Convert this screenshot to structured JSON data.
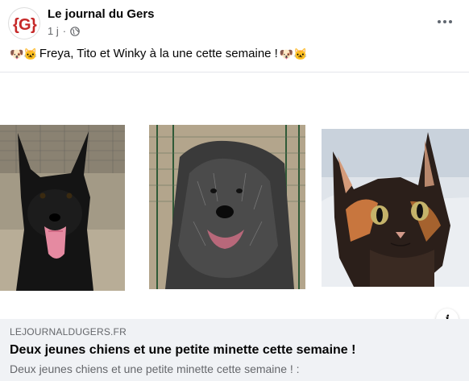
{
  "header": {
    "page_name": "Le journal du Gers",
    "timestamp": "1 j",
    "separator": "·",
    "avatar_letter": "G",
    "avatar_color": "#c62828",
    "privacy_icon": "globe-icon",
    "more_icon": "more-options-icon"
  },
  "post": {
    "caption_emoji_left": "🐶🐱",
    "caption_text": "Freya, Tito et Winky à la une cette semaine !",
    "caption_emoji_right": "🐶🐱"
  },
  "media": {
    "photos": [
      {
        "subject": "black-dog-photo"
      },
      {
        "subject": "shaggy-grey-dog-photo"
      },
      {
        "subject": "tortoiseshell-kitten-photo"
      }
    ],
    "info_label": "i"
  },
  "link_preview": {
    "domain": "LEJOURNALDUGERS.FR",
    "title": "Deux jeunes chiens et une petite minette cette semaine !",
    "description": "Deux jeunes chiens et une petite minette cette semaine ! :"
  },
  "colors": {
    "secondary_text": "#65676b",
    "preview_bg": "#f0f2f5",
    "divider": "#e4e6eb"
  }
}
